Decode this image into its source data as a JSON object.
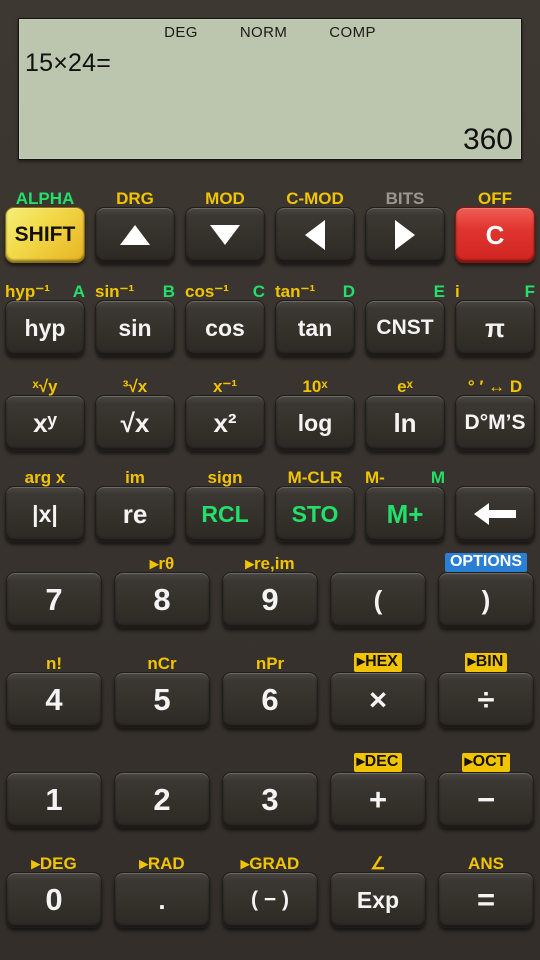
{
  "display": {
    "status": [
      "DEG",
      "NORM",
      "COMP"
    ],
    "expression": "15×24=",
    "result": "360"
  },
  "colors": {
    "background": "#3a3530",
    "lcd": "#bcc5ae",
    "shift_yellow": "#f2d948",
    "clear_red": "#e0352f",
    "alpha_green": "#22e06a",
    "label_yellow": "#f2c400",
    "label_gray": "#9b9690",
    "options_blue": "#2a7fd4"
  },
  "rows": [
    {
      "name": "row-function-nav",
      "keys": [
        {
          "name": "shift",
          "face": "SHIFT",
          "style": "shift",
          "top_yellow": "ALPHA",
          "top_style": "green"
        },
        {
          "name": "arrow-up",
          "icon": "arrow-up-icon",
          "top_yellow": "DRG"
        },
        {
          "name": "arrow-down",
          "icon": "arrow-down-icon",
          "top_yellow": "MOD"
        },
        {
          "name": "arrow-left",
          "icon": "arrow-left-icon",
          "top_yellow": "C-MOD"
        },
        {
          "name": "arrow-right",
          "icon": "arrow-right-icon",
          "top_yellow": "BITS",
          "top_style": "gray"
        },
        {
          "name": "clear",
          "face": "C",
          "style": "red",
          "top_yellow": "OFF"
        }
      ]
    },
    {
      "name": "row-trig",
      "keys": [
        {
          "name": "hyp",
          "face": "hyp",
          "shift_label": "hyp⁻¹",
          "alpha_label": "A"
        },
        {
          "name": "sin",
          "face": "sin",
          "shift_label": "sin⁻¹",
          "alpha_label": "B"
        },
        {
          "name": "cos",
          "face": "cos",
          "shift_label": "cos⁻¹",
          "alpha_label": "C"
        },
        {
          "name": "tan",
          "face": "tan",
          "shift_label": "tan⁻¹",
          "alpha_label": "D"
        },
        {
          "name": "cnst",
          "face": "CNST",
          "shift_label": "",
          "alpha_label": "E"
        },
        {
          "name": "pi",
          "face": "π",
          "shift_label": "i",
          "alpha_label": "F"
        }
      ]
    },
    {
      "name": "row-power",
      "keys": [
        {
          "name": "power-xy",
          "face": "xʸ",
          "shift_label": "ˣ√y"
        },
        {
          "name": "square-root",
          "face": "√x",
          "shift_label": "³√x"
        },
        {
          "name": "square",
          "face": "x²",
          "shift_label": "x⁻¹"
        },
        {
          "name": "log",
          "face": "log",
          "shift_label": "10ˣ"
        },
        {
          "name": "ln",
          "face": "ln",
          "shift_label": "eˣ"
        },
        {
          "name": "degrees-minutes-seconds",
          "face": "D°M’S",
          "shift_label": "° ′ ↔ D"
        }
      ]
    },
    {
      "name": "row-memory",
      "keys": [
        {
          "name": "absolute-value",
          "face": "|x|",
          "shift_label": "arg x"
        },
        {
          "name": "real-part",
          "face": "re",
          "shift_label": "im"
        },
        {
          "name": "recall",
          "face": "RCL",
          "style": "green",
          "shift_label": "sign"
        },
        {
          "name": "store",
          "face": "STO",
          "style": "green",
          "shift_label": "M-CLR"
        },
        {
          "name": "memory-plus",
          "face": "M+",
          "style": "green",
          "shift_label": "M-",
          "alpha_label": "M"
        },
        {
          "name": "backspace",
          "icon": "backspace-icon"
        }
      ]
    },
    {
      "name": "row-789",
      "keys": [
        {
          "name": "digit-7",
          "face": "7"
        },
        {
          "name": "digit-8",
          "face": "8",
          "shift_label": "▸rθ"
        },
        {
          "name": "digit-9",
          "face": "9",
          "shift_label": "▸re,im"
        },
        {
          "name": "open-paren",
          "face": "("
        },
        {
          "name": "close-paren",
          "face": ")",
          "badge": "OPTIONS",
          "badge_style": "blue"
        }
      ]
    },
    {
      "name": "row-456",
      "keys": [
        {
          "name": "digit-4",
          "face": "4",
          "shift_label": "n!"
        },
        {
          "name": "digit-5",
          "face": "5",
          "shift_label": "nCr"
        },
        {
          "name": "digit-6",
          "face": "6",
          "shift_label": "nPr"
        },
        {
          "name": "multiply",
          "face": "×",
          "badge": "▸HEX",
          "badge_style": "yellow"
        },
        {
          "name": "divide",
          "face": "÷",
          "badge": "▸BIN",
          "badge_style": "yellow"
        }
      ]
    },
    {
      "name": "row-123",
      "keys": [
        {
          "name": "digit-1",
          "face": "1"
        },
        {
          "name": "digit-2",
          "face": "2"
        },
        {
          "name": "digit-3",
          "face": "3"
        },
        {
          "name": "plus",
          "face": "+",
          "badge": "▸DEC",
          "badge_style": "yellow"
        },
        {
          "name": "minus",
          "face": "−",
          "badge": "▸OCT",
          "badge_style": "yellow"
        }
      ]
    },
    {
      "name": "row-zero",
      "keys": [
        {
          "name": "digit-0",
          "face": "0",
          "shift_label": "▸DEG"
        },
        {
          "name": "decimal-point",
          "face": ".",
          "shift_label": "▸RAD"
        },
        {
          "name": "negate",
          "face": "( − )",
          "shift_label": "▸GRAD"
        },
        {
          "name": "exponent",
          "face": "Exp",
          "shift_label": "∠"
        },
        {
          "name": "equals",
          "face": "=",
          "shift_label": "ANS"
        }
      ]
    }
  ]
}
